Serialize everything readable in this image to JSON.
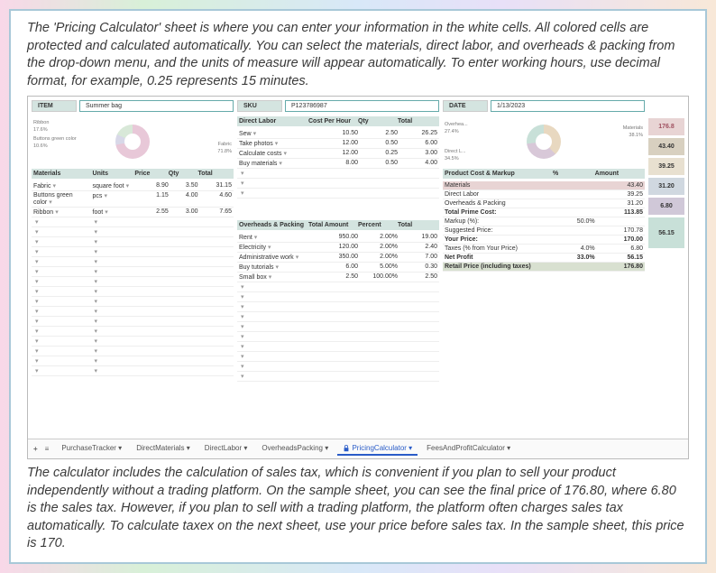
{
  "intro_text": "The 'Pricing Calculator' sheet is where you can enter your information in the white cells. All colored cells are protected and calculated automatically. You can select the materials, direct labor, and overheads & packing from the drop-down menu, and the units of measure will appear automatically. To enter working hours, use decimal format, for example, 0.25 represents 15 minutes.",
  "outro_text": "The calculator includes the calculation of sales tax, which is convenient if you plan to sell your product independently without a trading platform. On the sample sheet, you can see the final price of 176.80, where 6.80 is the sales tax. However, if you plan to sell with a trading platform, the platform often charges sales tax automatically. To calculate taxex on the next sheet, use your price before sales tax. In the sample sheet, this price is 170.",
  "sheet": {
    "item": {
      "label": "ITEM",
      "value": "Summer bag"
    },
    "sku": {
      "label": "SKU",
      "value": "P123786987"
    },
    "date": {
      "label": "DATE",
      "value": "1/13/2023"
    },
    "donut1": {
      "a": "Ribbon",
      "ap": "17.6%",
      "b": "Buttons green color",
      "bp": "10.6%",
      "c": "Fabric",
      "cp": "71.8%"
    },
    "donut2": {
      "a": "Overhea...",
      "ap": "27.4%",
      "b": "Direct L...",
      "bp": "34.5%",
      "c": "Materials",
      "cp": "38.1%"
    },
    "materials": {
      "header": [
        "Materials",
        "Units",
        "Price",
        "Qty",
        "Total"
      ],
      "rows": [
        [
          "Fabric",
          "square foot",
          "8.90",
          "3.50",
          "31.15"
        ],
        [
          "Buttons green color",
          "pcs",
          "1.15",
          "4.00",
          "4.60"
        ],
        [
          "Ribbon",
          "foot",
          "2.55",
          "3.00",
          "7.65"
        ]
      ]
    },
    "labor": {
      "header": [
        "Direct Labor",
        "Cost Per Hour",
        "Qty",
        "Total"
      ],
      "rows": [
        [
          "Sew",
          "10.50",
          "2.50",
          "26.25"
        ],
        [
          "Take photos",
          "12.00",
          "0.50",
          "6.00"
        ],
        [
          "Calculate costs",
          "12.00",
          "0.25",
          "3.00"
        ],
        [
          "Buy materials",
          "8.00",
          "0.50",
          "4.00"
        ]
      ]
    },
    "overheads": {
      "header": [
        "Overheads & Packing",
        "Total Amount",
        "Percent",
        "Total"
      ],
      "rows": [
        [
          "Rent",
          "950.00",
          "2.00%",
          "19.00"
        ],
        [
          "Electricity",
          "120.00",
          "2.00%",
          "2.40"
        ],
        [
          "Administrative work",
          "350.00",
          "2.00%",
          "7.00"
        ],
        [
          "Buy tutorials",
          "6.00",
          "5.00%",
          "0.30"
        ],
        [
          "Small box",
          "2.50",
          "100.00%",
          "2.50"
        ]
      ]
    },
    "markup": {
      "header": [
        "Product Cost & Markup",
        "%",
        "Amount"
      ],
      "rows": [
        {
          "name": "Materials",
          "pct": "",
          "amt": "43.40",
          "cls": "highlight"
        },
        {
          "name": "Direct Labor",
          "pct": "",
          "amt": "39.25",
          "cls": ""
        },
        {
          "name": "Overheads & Packing",
          "pct": "",
          "amt": "31.20",
          "cls": ""
        },
        {
          "name": "Total Prime Cost:",
          "pct": "",
          "amt": "113.85",
          "cls": "bold"
        },
        {
          "name": "Markup (%):",
          "pct": "50.0%",
          "amt": "",
          "cls": ""
        },
        {
          "name": "Suggested Price:",
          "pct": "",
          "amt": "170.78",
          "cls": ""
        },
        {
          "name": "Your Price:",
          "pct": "",
          "amt": "170.00",
          "cls": "bold"
        },
        {
          "name": "Taxes (% from Your Price)",
          "pct": "4.0%",
          "amt": "6.80",
          "cls": ""
        },
        {
          "name": "Net Profit",
          "pct": "33.0%",
          "amt": "56.15",
          "cls": "bold"
        },
        {
          "name": "Retail Price (including taxes)",
          "pct": "",
          "amt": "176.80",
          "cls": "highlight2 bold"
        }
      ]
    },
    "sidebar": [
      "176.8",
      "43.40",
      "39.25",
      "31.20",
      "6.80",
      "56.15"
    ]
  },
  "tabs": {
    "items": [
      "PurchaseTracker",
      "DirectMaterials",
      "DirectLabor",
      "OverheadsPacking",
      "PricingCalculator",
      "FeesAndProfitCalculator"
    ],
    "active": 4
  }
}
